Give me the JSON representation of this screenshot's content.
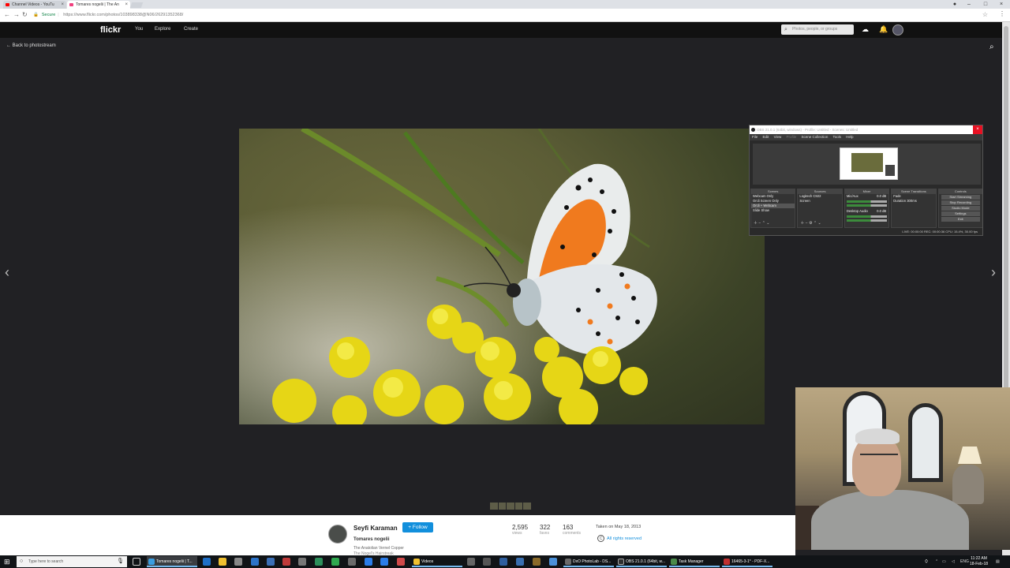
{
  "browser": {
    "tabs": [
      {
        "title": "Channel Videos - YouTu",
        "favicon_color": "#ff0000"
      },
      {
        "title": "Tomares nogelii | The An",
        "favicon_color": "#f0407f"
      }
    ],
    "secure_label": "Secure",
    "url": "https://www.flickr.com/photos/103898338@N06/26291352368/"
  },
  "flickr": {
    "logo": "flickr",
    "nav": [
      "You",
      "Explore",
      "Create"
    ],
    "search_placeholder": "Photos, people, or groups",
    "back_label": "Back to photostream"
  },
  "photo_info": {
    "owner": "Seyfi Karaman",
    "follow_label": "+ Follow",
    "title": "Tomares nogelii",
    "description": "The Anatolian Vernel Copper",
    "description2": "The Nogel's Hairstreak",
    "stats": [
      {
        "number": "2,595",
        "label": "views"
      },
      {
        "number": "322",
        "label": "faves"
      },
      {
        "number": "163",
        "label": "comments"
      }
    ],
    "taken": "Taken on May 18, 2013",
    "rights_symbol": "C",
    "rights": "All rights reserved"
  },
  "obs": {
    "title": "OBS 21.0.1 (64bit, windows) - Profile: Untitled - Scenes: Untitled",
    "menu": [
      "File",
      "Edit",
      "View",
      "Profile",
      "Scene Collection",
      "Tools",
      "Help"
    ],
    "docks": {
      "scenes_header": "Scenes",
      "scenes": [
        "Webcam Only",
        "Orcli Screen Only",
        "Orcli + Webcam",
        "Slide Show"
      ],
      "sources_header": "Sources",
      "sources": [
        "Logitech C922",
        "Screen"
      ],
      "mixer_header": "Mixer",
      "mixer": [
        {
          "name": "Mic/Aux",
          "db": "0.0 dB"
        },
        {
          "name": "Desktop Audio",
          "db": "0.0 dB"
        }
      ],
      "transitions_header": "Scene Transitions",
      "transition_value": "Fade",
      "duration_label": "Duration",
      "duration_value": "300ms",
      "controls_header": "Controls",
      "controls": [
        "Start Streaming",
        "Stop Recording",
        "Studio Mode",
        "Settings",
        "Exit"
      ]
    },
    "status": "LIVE: 00:00:00    REC: 00:00:36    CPU: 15.4%, 30.00 fps"
  },
  "taskbar": {
    "search_placeholder": "Type here to search",
    "apps": [
      {
        "label": "Tomares nogelii | T...",
        "color": "#3b9de0"
      },
      {
        "label": "Videos",
        "color": "#f0c030"
      },
      {
        "label": "DxO PhotoLab - DS...",
        "color": "#6a6a6a"
      },
      {
        "label": "OBS 21.0.1 (64bit, w...",
        "color": "#303030"
      },
      {
        "label": "Task Manager",
        "color": "#4a8a4a"
      },
      {
        "label": "16465-3-1* - PDF-X...",
        "color": "#c03030"
      }
    ],
    "tray_lang": "ENG",
    "time": "11:22 AM",
    "date": "18-Feb-18"
  },
  "colors": {
    "flickr_blue": "#128fdc",
    "page_bg": "#212124"
  }
}
